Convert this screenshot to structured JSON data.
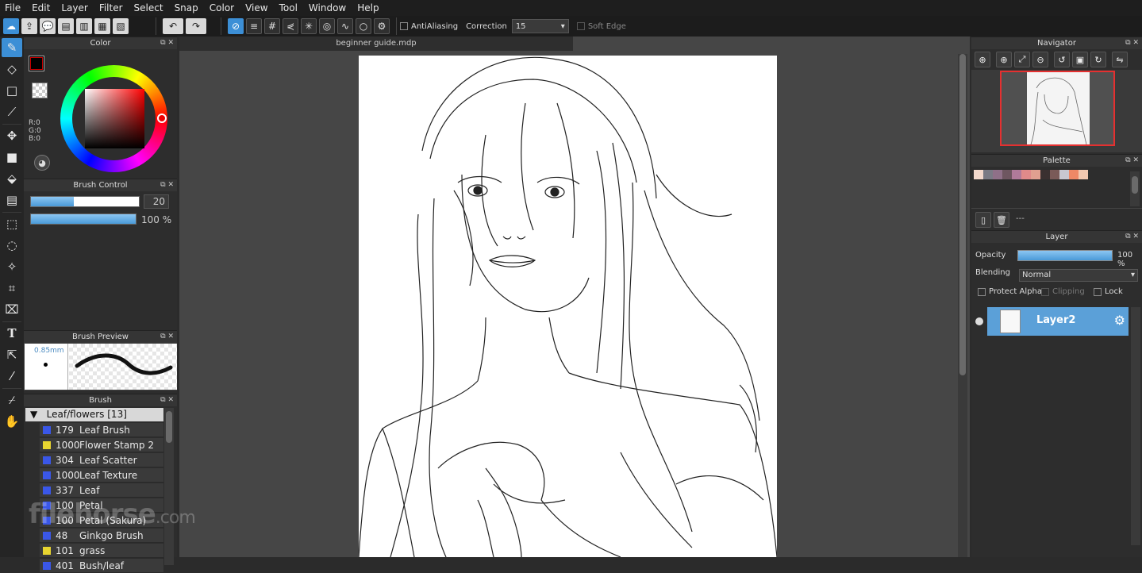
{
  "menu": [
    "File",
    "Edit",
    "Layer",
    "Filter",
    "Select",
    "Snap",
    "Color",
    "View",
    "Tool",
    "Window",
    "Help"
  ],
  "toolbar": {
    "antialiasing_label": "AntiAliasing",
    "correction_label": "Correction",
    "correction_value": "15",
    "soft_edge_label": "Soft Edge"
  },
  "panels": {
    "color": {
      "title": "Color",
      "r": "R:0",
      "g": "G:0",
      "b": "B:0"
    },
    "brush_control": {
      "title": "Brush Control",
      "size_value": "20",
      "opacity_value": "100 %",
      "size_fraction": 0.4,
      "opacity_fraction": 1.0
    },
    "brush_preview": {
      "title": "Brush Preview",
      "size_label": "0.85mm"
    },
    "brush": {
      "title": "Brush",
      "category": "Leaf/flowers [13]",
      "items": [
        {
          "num": "179",
          "name": "Leaf Brush",
          "color": "#3a57e8"
        },
        {
          "num": "1000",
          "name": "Flower Stamp 2",
          "color": "#e8d530"
        },
        {
          "num": "304",
          "name": "Leaf Scatter",
          "color": "#3a57e8"
        },
        {
          "num": "1000",
          "name": "Leaf Texture",
          "color": "#3a57e8"
        },
        {
          "num": "337",
          "name": "Leaf",
          "color": "#3a57e8"
        },
        {
          "num": "100",
          "name": "Petal",
          "color": "#3a57e8"
        },
        {
          "num": "100",
          "name": "Petal (Sakura)",
          "color": "#3a57e8"
        },
        {
          "num": "48",
          "name": "Ginkgo Brush",
          "color": "#3a57e8"
        },
        {
          "num": "101",
          "name": "grass",
          "color": "#e8d530"
        },
        {
          "num": "401",
          "name": "Bush/leaf",
          "color": "#3a57e8"
        }
      ]
    }
  },
  "document": {
    "tab": "beginner guide.mdp"
  },
  "navigator": {
    "title": "Navigator"
  },
  "palette": {
    "title": "Palette",
    "swatches": [
      "#f2d8cc",
      "#7a7a85",
      "#8f7088",
      "#6e5660",
      "#b07a9a",
      "#e08a8a",
      "#e0a090",
      "#3a3030",
      "#7a5a58",
      "#c8c8d0",
      "#ee8866",
      "#f2c8b0"
    ],
    "footer_label": "---"
  },
  "layer": {
    "title": "Layer",
    "opacity_label": "Opacity",
    "opacity_value": "100 %",
    "blending_label": "Blending",
    "blending_value": "Normal",
    "protect_alpha": "Protect Alpha",
    "clipping": "Clipping",
    "lock": "Lock",
    "layers": [
      {
        "name": "Layer2"
      }
    ]
  },
  "watermark": {
    "brand": "filehorse",
    "suffix": ".com"
  }
}
